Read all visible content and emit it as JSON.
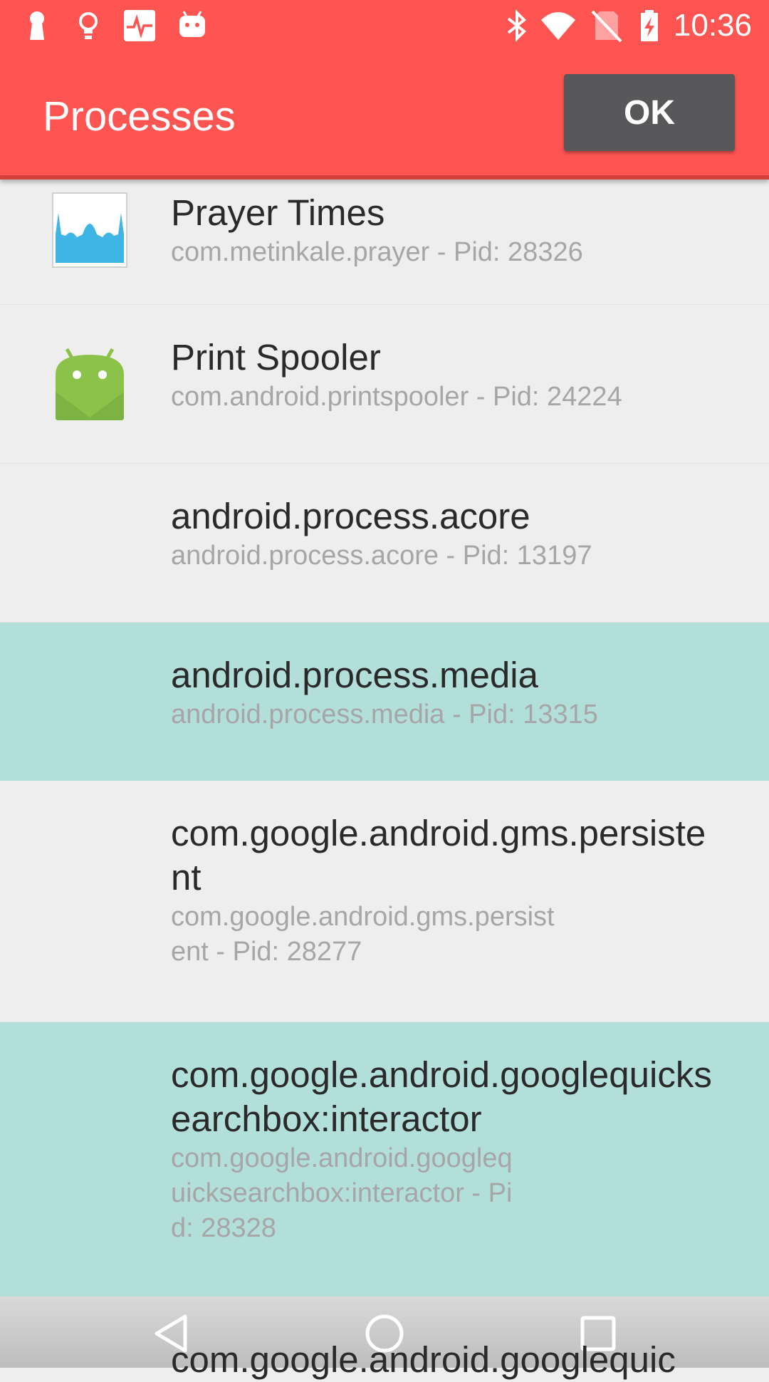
{
  "status_bar": {
    "time": "10:36",
    "left_icons": [
      "keyhole-icon",
      "lightbulb-icon",
      "heartbeat-icon",
      "android-face-icon"
    ],
    "right_icons": [
      "bluetooth-icon",
      "wifi-icon",
      "no-sim-icon",
      "battery-charging-icon"
    ]
  },
  "app_bar": {
    "title": "Processes",
    "ok_label": "OK"
  },
  "processes": [
    {
      "name": "Prayer Times",
      "detail": "com.metinkale.prayer - Pid: 28326",
      "icon": "mosque-icon",
      "selected": false
    },
    {
      "name": "Print Spooler",
      "detail": "com.android.printspooler - Pid: 24224",
      "icon": "android-robot-icon",
      "selected": false
    },
    {
      "name": "android.process.acore",
      "detail": "android.process.acore - Pid: 13197",
      "icon": null,
      "selected": false
    },
    {
      "name": "android.process.media",
      "detail": "android.process.media - Pid: 13315",
      "icon": null,
      "selected": true
    },
    {
      "name": "com.google.android.gms.persistent",
      "detail": "com.google.android.gms.persistent - Pid: 28277",
      "icon": null,
      "selected": false
    },
    {
      "name": "com.google.android.googlequicksearchbox:interactor",
      "detail": "com.google.android.googlequicksearchbox:interactor - Pid: 28328",
      "icon": null,
      "selected": true
    }
  ],
  "partial_next_row": "com.google.android.googlequic",
  "nav_bar": {
    "buttons": [
      "back-icon",
      "home-icon",
      "recents-icon"
    ]
  },
  "colors": {
    "app_bar": "#fe5552",
    "selected_row": "#b3dfdb",
    "ok_button": "#58585a"
  }
}
